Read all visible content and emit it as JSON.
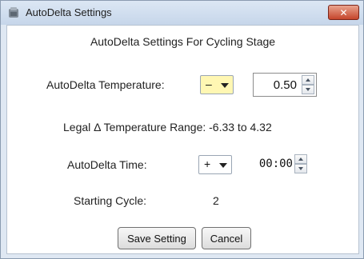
{
  "window": {
    "title": "AutoDelta Settings",
    "close_label": "✕"
  },
  "dialog": {
    "heading": "AutoDelta Settings For Cycling Stage",
    "temperature": {
      "label": "AutoDelta Temperature:",
      "sign": "–",
      "value": "0.50"
    },
    "legal_range": "Legal Δ Temperature Range: -6.33 to 4.32",
    "time": {
      "label": "AutoDelta Time:",
      "sign": "+",
      "value": "00:00"
    },
    "starting_cycle": {
      "label": "Starting Cycle:",
      "value": "2"
    }
  },
  "buttons": {
    "save": "Save Setting",
    "cancel": "Cancel"
  },
  "colors": {
    "sign_highlight": "#fff7b3",
    "close_red": "#c5452b"
  }
}
